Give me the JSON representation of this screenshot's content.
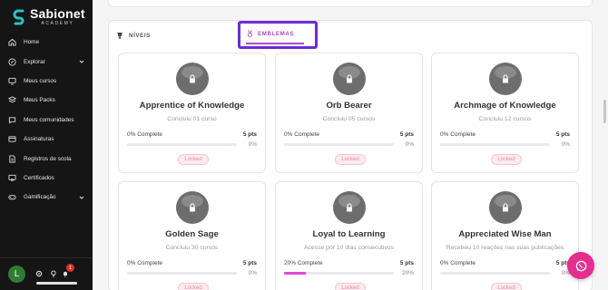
{
  "brand": {
    "name": "Sabionet",
    "sub": "ACADEMY"
  },
  "sidebar": {
    "items": [
      {
        "label": "Home",
        "icon": "home-icon"
      },
      {
        "label": "Explorar",
        "icon": "compass-icon",
        "has_chevron": true
      },
      {
        "label": "Meus cursos",
        "icon": "monitor-icon"
      },
      {
        "label": "Meus Packs",
        "icon": "layers-icon"
      },
      {
        "label": "Meus comunidades",
        "icon": "chat-icon"
      },
      {
        "label": "Assinaturas",
        "icon": "card-icon"
      },
      {
        "label": "Registros de scola",
        "icon": "document-icon"
      },
      {
        "label": "Certificados",
        "icon": "certificate-icon"
      },
      {
        "label": "Gamificação",
        "icon": "gamepad-icon",
        "has_chevron": true
      }
    ]
  },
  "user": {
    "avatar_letter": "L",
    "notification_count": "1"
  },
  "tabs": {
    "niveis": "NÍVEIS",
    "emblemas": "EMBLEMAS"
  },
  "colors": {
    "accent": "#6c2bd9",
    "pink": "#e04bd4",
    "fab": "#e62e8f"
  },
  "cards": [
    {
      "title": "Apprentice of Knowledge",
      "desc": "Concluiu 01 curso",
      "progress_label": "0% Complete",
      "pts": "5 pts",
      "pct": "0%",
      "progress": 0,
      "status": "Locked"
    },
    {
      "title": "Orb Bearer",
      "desc": "Concluiu 05 cursos",
      "progress_label": "0% Complete",
      "pts": "5 pts",
      "pct": "0%",
      "progress": 0,
      "status": "Locked"
    },
    {
      "title": "Archmage of Knowledge",
      "desc": "Concluiu 12 cursos",
      "progress_label": "0% Complete",
      "pts": "5 pts",
      "pct": "0%",
      "progress": 0,
      "status": "Locked"
    },
    {
      "title": "Golden Sage",
      "desc": "Concluiu 30 cursos",
      "progress_label": "0% Complete",
      "pts": "5 pts",
      "pct": "0%",
      "progress": 0,
      "status": "Locked"
    },
    {
      "title": "Loyal to Learning",
      "desc": "Acesse por 10 dias consecutivos",
      "progress_label": "20% Complete",
      "pts": "5 pts",
      "pct": "20%",
      "progress": 20,
      "status": "Locked"
    },
    {
      "title": "Appreciated Wise Man",
      "desc": "Recebeu 10 reações nas suas publicações",
      "progress_label": "0% Complete",
      "pts": "5 pts",
      "pct": "0%",
      "progress": 0,
      "status": "Locked"
    }
  ]
}
